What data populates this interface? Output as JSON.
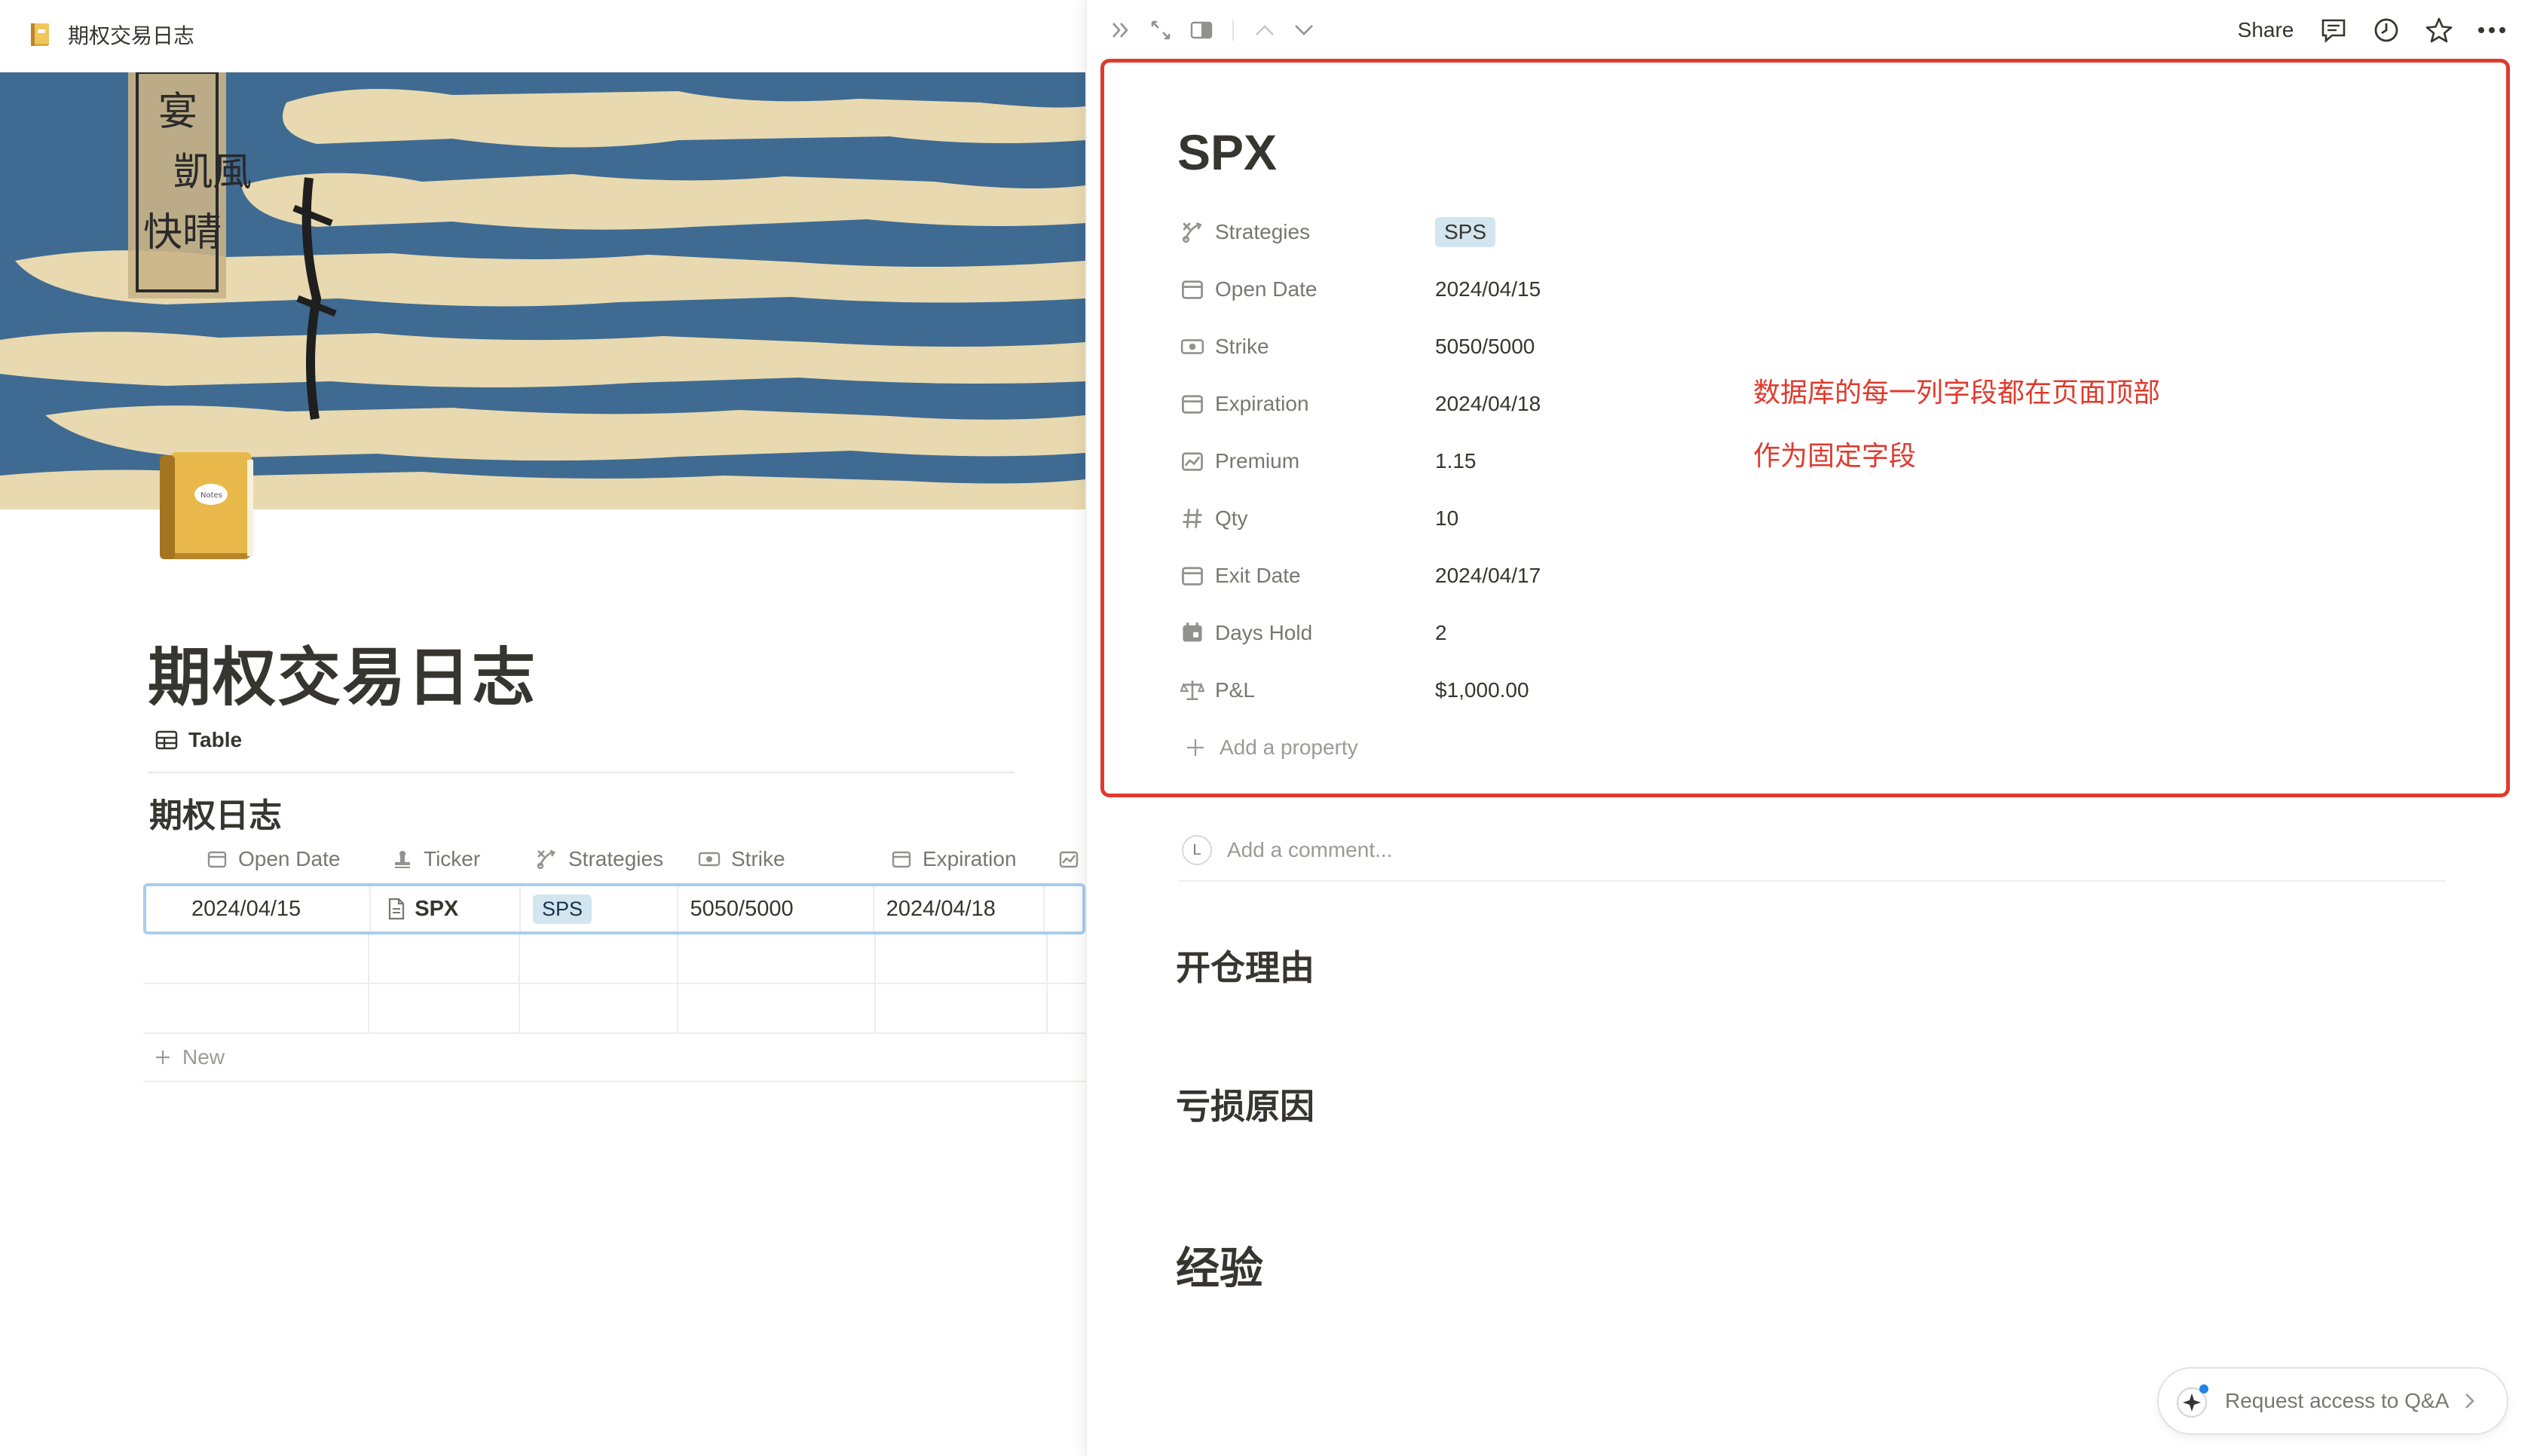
{
  "breadcrumb": {
    "title": "期权交易日志"
  },
  "page": {
    "title": "期权交易日志"
  },
  "view": {
    "tab_label": "Table"
  },
  "database": {
    "title": "期权日志",
    "columns": [
      "Open Date",
      "Ticker",
      "Strategies",
      "Strike",
      "Expiration"
    ],
    "rows": [
      {
        "open_date": "2024/04/15",
        "ticker": "SPX",
        "strategy": "SPS",
        "strike": "5050/5000",
        "expiration": "2024/04/18"
      }
    ],
    "new_label": "New"
  },
  "peek_toolbar": {
    "share_label": "Share"
  },
  "record": {
    "title": "SPX",
    "properties": [
      {
        "name": "Strategies",
        "value": "SPS",
        "icon": "strategies-icon"
      },
      {
        "name": "Open Date",
        "value": "2024/04/15",
        "icon": "calendar-icon"
      },
      {
        "name": "Strike",
        "value": "5050/5000",
        "icon": "money-icon"
      },
      {
        "name": "Expiration",
        "value": "2024/04/18",
        "icon": "calendar-icon"
      },
      {
        "name": "Premium",
        "value": "1.15",
        "icon": "chart-icon"
      },
      {
        "name": "Qty",
        "value": "10",
        "icon": "hash-icon"
      },
      {
        "name": "Exit Date",
        "value": "2024/04/17",
        "icon": "calendar-icon"
      },
      {
        "name": "Days Hold",
        "value": "2",
        "icon": "calendar-dot-icon"
      },
      {
        "name": "P&L",
        "value": "$1,000.00",
        "icon": "scale-icon"
      }
    ],
    "add_property": "Add a property"
  },
  "annotation": {
    "line1": "数据库的每一列字段都在页面顶部",
    "line2": "作为固定字段",
    "color": "#e03a2d"
  },
  "comment": {
    "avatar_letter": "L",
    "placeholder": "Add a comment..."
  },
  "sections": {
    "s1": "开仓理由",
    "s2": "亏损原因",
    "s3": "经验"
  },
  "qa_button": {
    "label": "Request access to Q&A"
  },
  "colors": {
    "tag_bg": "#d3e5ef",
    "selection_border": "#aacdec",
    "frame": "#e03a2d"
  }
}
